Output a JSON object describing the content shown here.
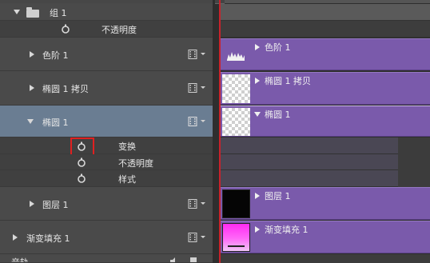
{
  "layers": [
    {
      "id": "group1",
      "name": "组 1",
      "kind": "group",
      "expanded": true
    },
    {
      "id": "group1-opacity",
      "name": "不透明度",
      "kind": "property"
    },
    {
      "id": "levels1",
      "name": "色阶 1",
      "kind": "layer",
      "expanded": false
    },
    {
      "id": "ellipse1copy",
      "name": "椭圆 1 拷贝",
      "kind": "layer",
      "expanded": false
    },
    {
      "id": "ellipse1",
      "name": "椭圆 1",
      "kind": "layer",
      "expanded": true,
      "selected": true
    },
    {
      "id": "ellipse1-transform",
      "name": "变换",
      "kind": "property",
      "highlighted": true
    },
    {
      "id": "ellipse1-opacity",
      "name": "不透明度",
      "kind": "property"
    },
    {
      "id": "ellipse1-style",
      "name": "样式",
      "kind": "property"
    },
    {
      "id": "layer1",
      "name": "图层 1",
      "kind": "layer",
      "expanded": false
    },
    {
      "id": "gradientfill1",
      "name": "渐变填充 1",
      "kind": "layer",
      "expanded": false
    },
    {
      "id": "audio",
      "name": "音轨",
      "kind": "layer",
      "expanded": false
    }
  ],
  "tracks": [
    {
      "label": "色阶 1",
      "thumb": "levels-icon"
    },
    {
      "label": "椭圆 1 拷贝",
      "thumb": "transparent"
    },
    {
      "label": "椭圆 1",
      "thumb": "transparent"
    },
    {
      "label": "图层 1",
      "thumb": "black"
    },
    {
      "label": "渐变填充 1",
      "thumb": "gradient"
    }
  ],
  "colors": {
    "track_purple": "#7a5aab",
    "selected_row": "#6a7d92",
    "playhead": "#c8232c",
    "highlight_box": "#e02020"
  }
}
